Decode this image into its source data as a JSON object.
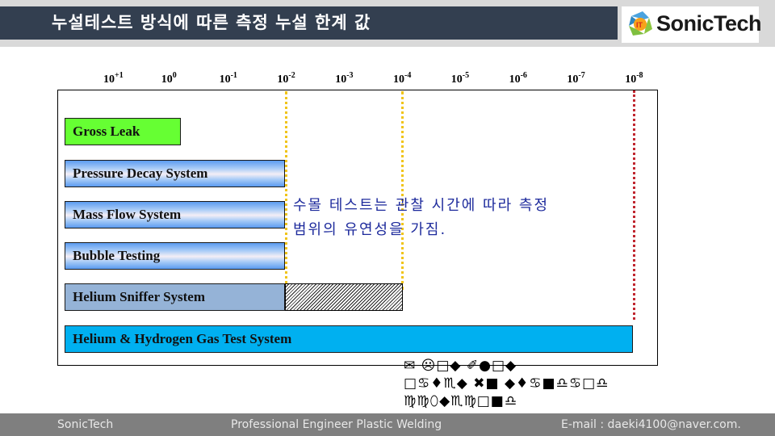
{
  "header": {
    "title": "누설테스트 방식에 따른 측정 누설 한계 값",
    "logo_text": "SonicTech",
    "logo_icon": "sonictech-logo-icon"
  },
  "diagram": {
    "scale_ticks": [
      {
        "base": "10",
        "exp": "+1"
      },
      {
        "base": "10",
        "exp": "0"
      },
      {
        "base": "10",
        "exp": "-1"
      },
      {
        "base": "10",
        "exp": "-2"
      },
      {
        "base": "10",
        "exp": "-3"
      },
      {
        "base": "10",
        "exp": "-4"
      },
      {
        "base": "10",
        "exp": "-5"
      },
      {
        "base": "10",
        "exp": "-6"
      },
      {
        "base": "10",
        "exp": "-7"
      },
      {
        "base": "10",
        "exp": "-8"
      }
    ],
    "reference_lines": [
      {
        "at_exponent": -2,
        "style": "dotted",
        "color": "#f0c419"
      },
      {
        "at_exponent": -4,
        "style": "dotted",
        "color": "#f0c419"
      },
      {
        "at_exponent": -8,
        "style": "dotted",
        "color": "#c0262f"
      }
    ],
    "methods": [
      {
        "label": "Gross Leak",
        "range_exponents": [
          1,
          -0.2
        ],
        "color": "#66ff33"
      },
      {
        "label": "Pressure Decay System",
        "range_exponents": [
          1,
          -2
        ],
        "color": "gradient-blue"
      },
      {
        "label": "Mass Flow System",
        "range_exponents": [
          1,
          -2
        ],
        "color": "gradient-blue"
      },
      {
        "label": "Bubble Testing",
        "range_exponents": [
          1,
          -2
        ],
        "color": "gradient-blue"
      },
      {
        "label": "Helium Sniffer System",
        "range_exponents": [
          1,
          -2
        ],
        "extended_range_exponents": [
          -2,
          -4
        ],
        "color": "#95b3d7"
      },
      {
        "label": "Helium & Hydrogen Gas Test System",
        "range_exponents": [
          1,
          -8
        ],
        "color": "#00b0f0"
      }
    ],
    "note_line1": "수몰 테스트는 관찰 시간에 따라 측정",
    "note_line2": "범위의 유연성을 가짐.",
    "footnote_line1": "✉ ☹□◆ ✐●□◆",
    "footnote_line2": "□♋♦♏◆ ✖■ ◆♦♋■♎♋□♎",
    "footnote_line3": "♍♍⬯◆♏♍□■♎"
  },
  "footer": {
    "company": "SonicTech",
    "tagline": "Professional Engineer Plastic Welding",
    "email": "E-mail : daeki4100@naver.com."
  }
}
